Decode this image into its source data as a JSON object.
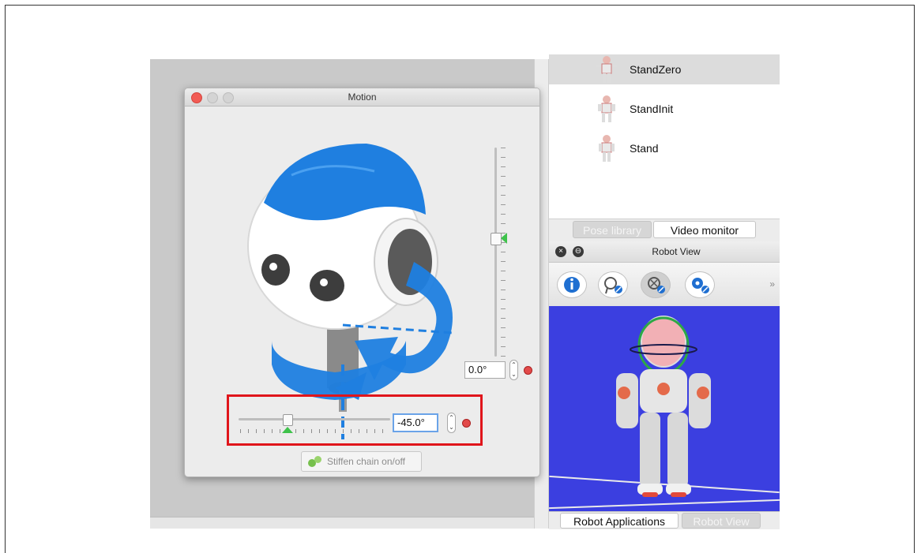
{
  "motion_window": {
    "title": "Motion",
    "vertical_value": "0.0°",
    "horizontal_value": "-45.0°",
    "stiffen_label": "Stiffen chain on/off"
  },
  "pose_library": {
    "items": [
      {
        "label": "StandZero"
      },
      {
        "label": "StandInit"
      },
      {
        "label": "Stand"
      }
    ],
    "tabs": [
      {
        "label": "Pose library"
      },
      {
        "label": "Video monitor"
      }
    ]
  },
  "robot_view": {
    "title": "Robot View",
    "toolbar_more": "»",
    "bottom_tabs": [
      {
        "label": "Robot Applications"
      },
      {
        "label": "Robot View"
      }
    ]
  },
  "colors": {
    "highlight": "#e0151b",
    "viewport_bg": "#3b3fe0",
    "slider_marker": "#3ec24b",
    "robot_blue": "#1f7fe0"
  }
}
